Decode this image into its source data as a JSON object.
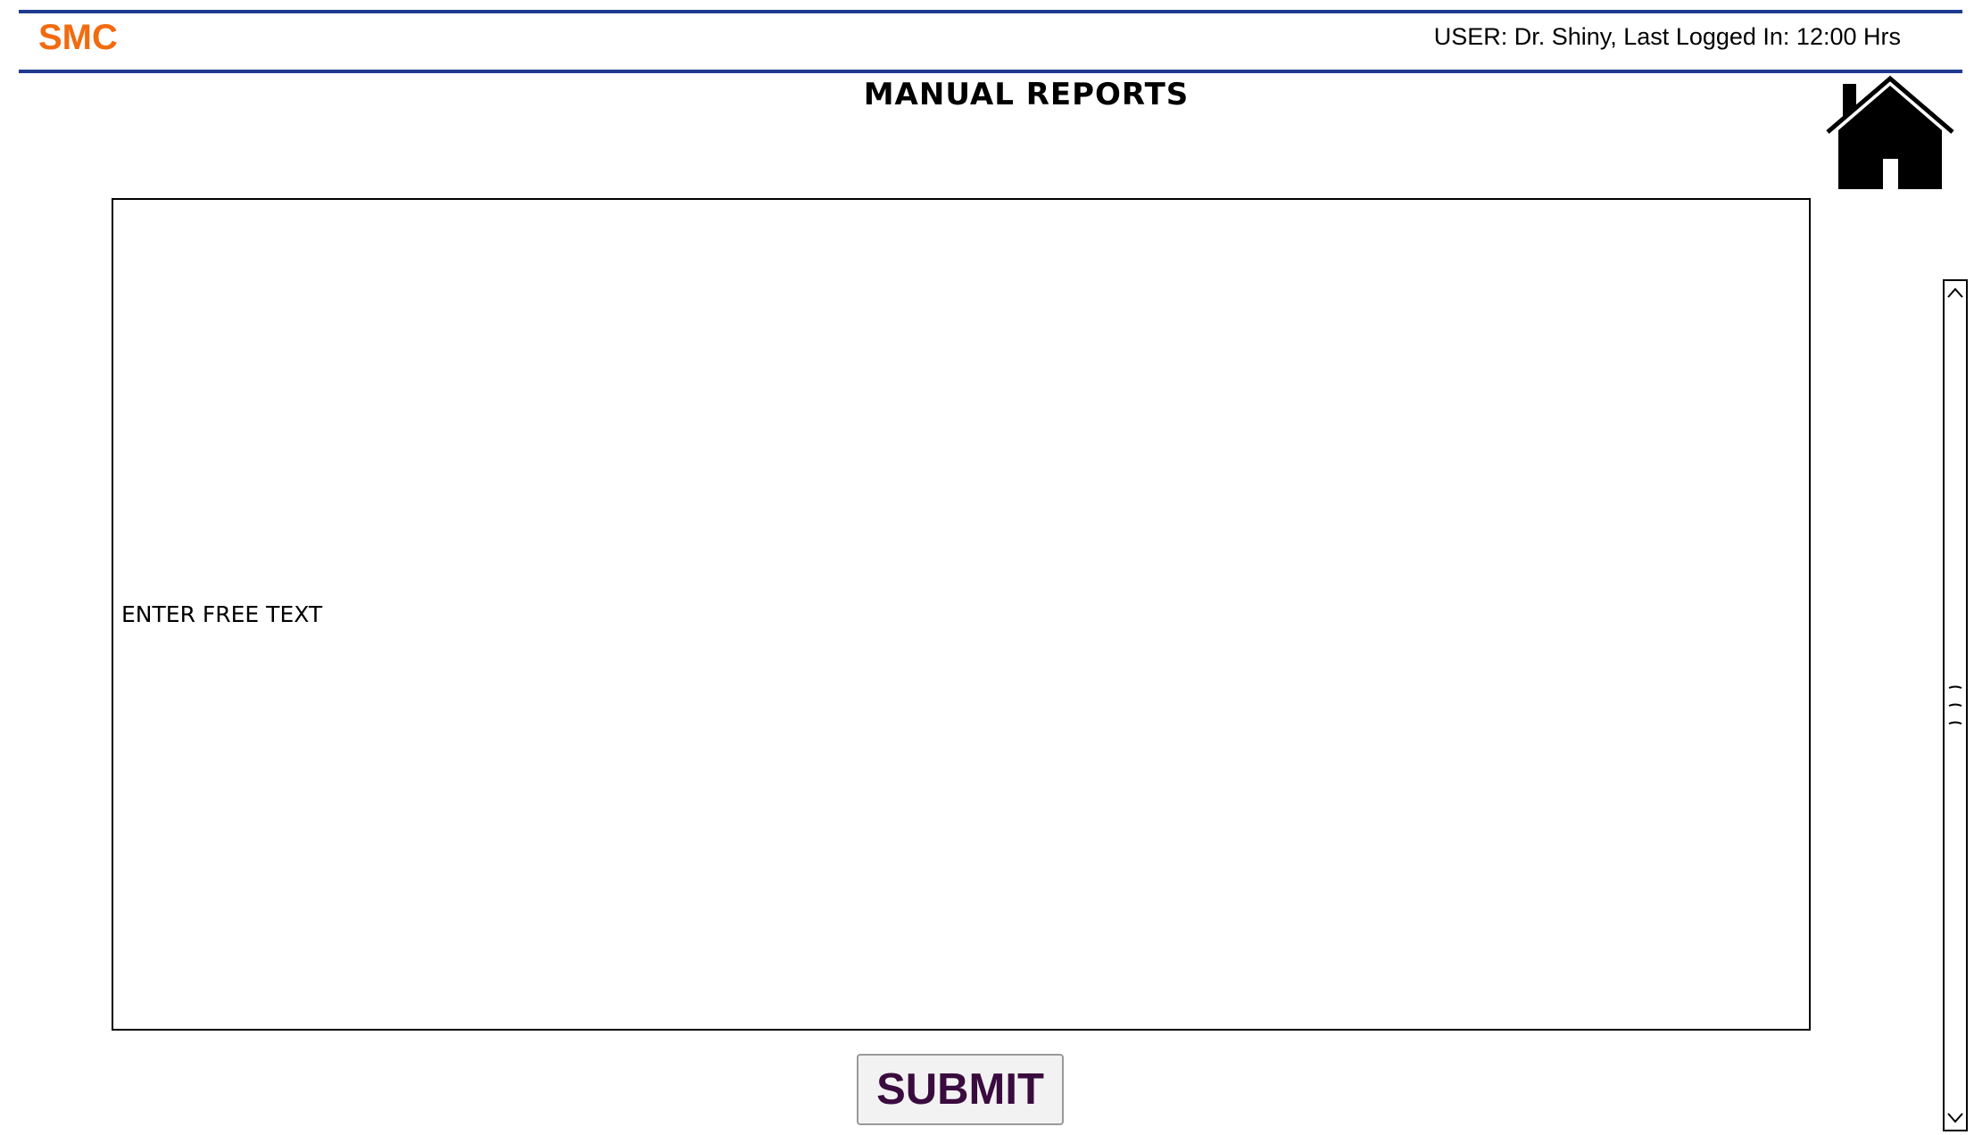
{
  "header": {
    "brand": "SMC",
    "user_info": "USER: Dr. Shiny, Last Logged In: 12:00 Hrs",
    "accent_color": "#1f3a8f",
    "brand_color": "#f26b0f"
  },
  "main": {
    "title": "MANUAL REPORTS",
    "home_icon": "home-icon",
    "free_text_placeholder": "ENTER FREE TEXT",
    "submit_label": "SUBMIT"
  },
  "scrollbar": {
    "up_icon": "chevron-up-icon",
    "down_icon": "chevron-down-icon"
  }
}
